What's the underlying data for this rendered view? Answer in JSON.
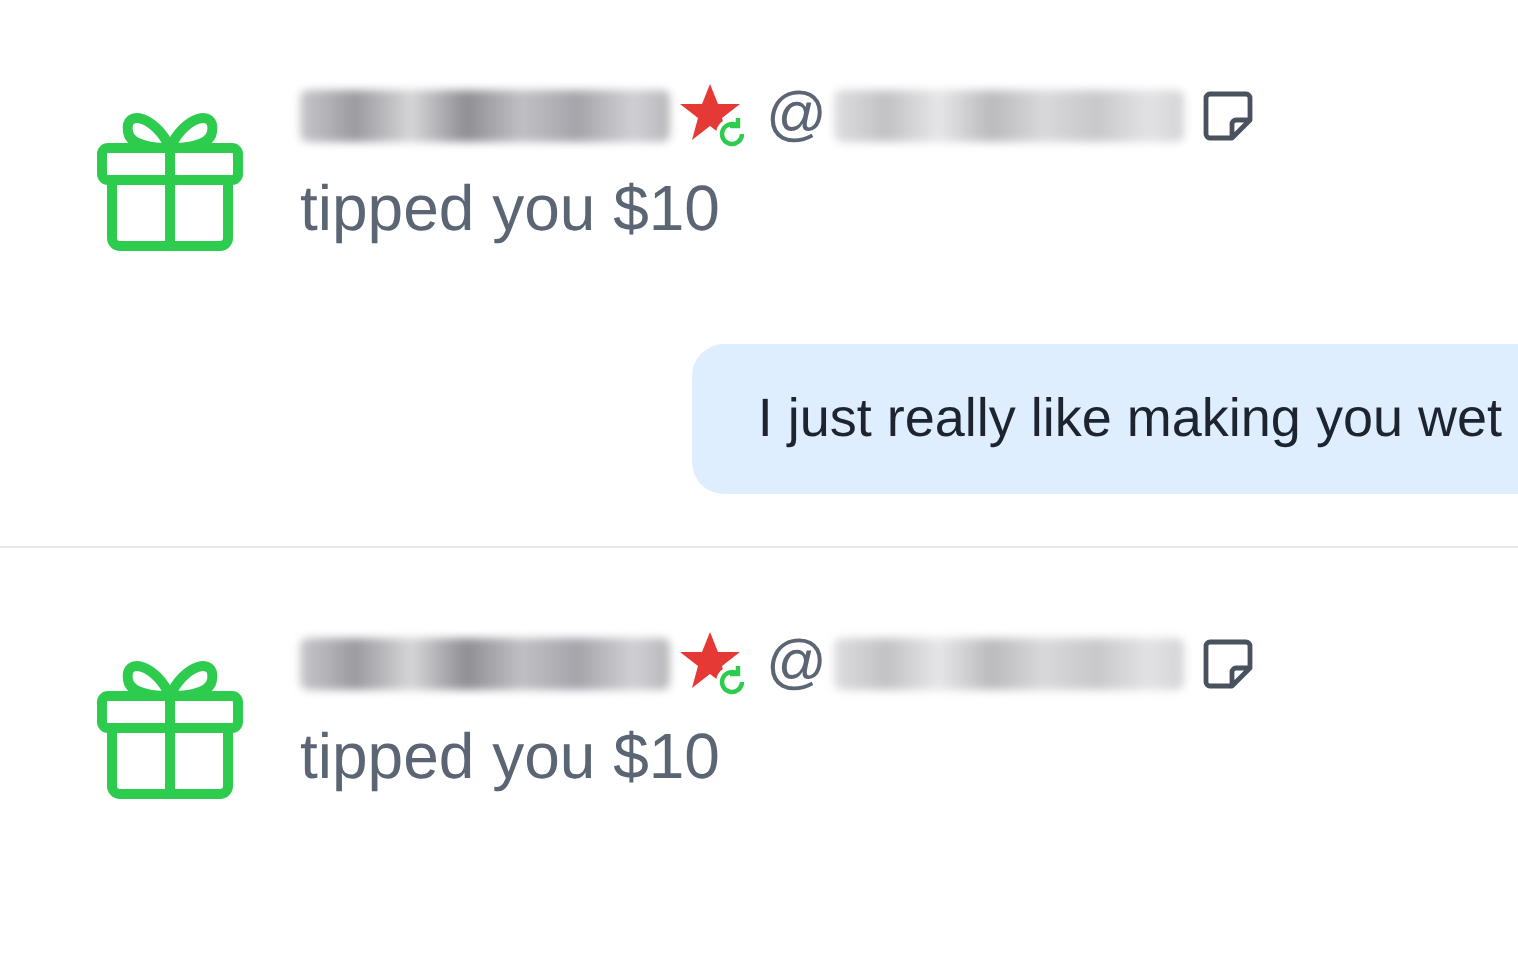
{
  "notifications": [
    {
      "at_sign": "@",
      "action": "tipped you $10",
      "message": "I just really like making you wet"
    },
    {
      "at_sign": "@",
      "action": "tipped you $10"
    }
  ]
}
